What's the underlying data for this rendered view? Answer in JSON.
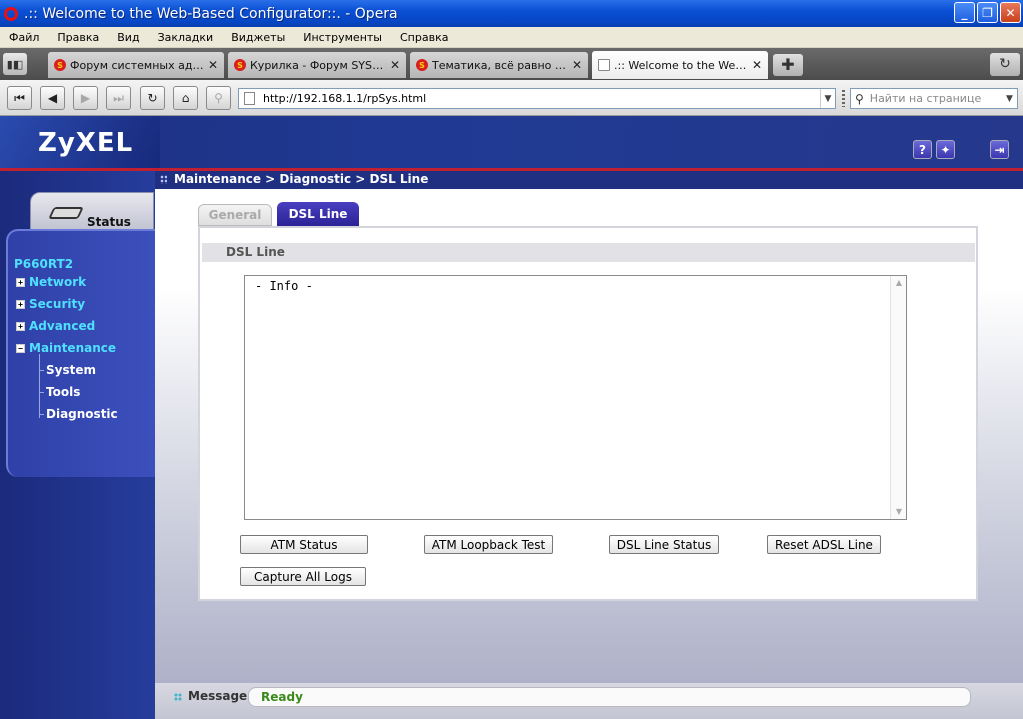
{
  "window": {
    "title": ".:: Welcome to the Web-Based Configurator::. - Opera"
  },
  "menu": [
    "Файл",
    "Правка",
    "Вид",
    "Закладки",
    "Виджеты",
    "Инструменты",
    "Справка"
  ],
  "tabs": [
    {
      "label": "Форум системных адми...",
      "active": false
    },
    {
      "label": "Курилка - Форум SYSAd...",
      "active": false
    },
    {
      "label": "Тематика, всё равно вс...",
      "active": false
    },
    {
      "label": ".:: Welcome to the Web-...",
      "active": true
    }
  ],
  "nav": {
    "url": "http://192.168.1.1/rpSys.html",
    "search_placeholder": "Найти на странице"
  },
  "router": {
    "brand": "ZyXEL",
    "breadcrumb": "Maintenance > Diagnostic > DSL Line",
    "status_tab": "Status",
    "model": "P660RT2",
    "sidebar": [
      {
        "label": "Network",
        "expanded": false
      },
      {
        "label": "Security",
        "expanded": false
      },
      {
        "label": "Advanced",
        "expanded": false
      },
      {
        "label": "Maintenance",
        "expanded": true
      }
    ],
    "submenu": [
      "System",
      "Tools",
      "Diagnostic"
    ],
    "content_tabs": [
      "General",
      "DSL Line"
    ],
    "section_title": "DSL Line",
    "info_text": "- Info -",
    "buttons": {
      "atm_status": "ATM Status",
      "atm_loopback": "ATM Loopback Test",
      "dsl_line_status": "DSL Line Status",
      "reset_adsl": "Reset ADSL Line",
      "capture_logs": "Capture All Logs"
    },
    "message_label": "Message",
    "message_value": "Ready"
  },
  "colors": {
    "accent_navy": "#1f2f82",
    "nav_cyan": "#4fe0ff",
    "tab_active": "#2c2296",
    "ready_green": "#3a8a1a",
    "header_red": "#c02030"
  }
}
